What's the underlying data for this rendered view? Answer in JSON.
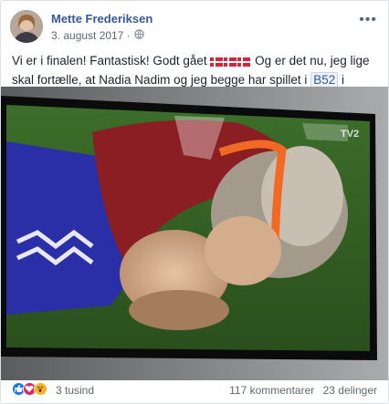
{
  "post": {
    "author": "Mette Frederiksen",
    "date": "3. august 2017 ·",
    "text_part1": "Vi er i finalen! Fantastisk! Godt gået",
    "text_part2": "Og er det nu, jeg lige skal fortælle, at Nadia Nadim og jeg begge har spillet i",
    "tag": "B52",
    "text_part3": "i Aalborg?",
    "emoji": "😀"
  },
  "footer": {
    "reaction_count": "3 tusind",
    "comments": "117 kommentarer",
    "shares": "23 delinger"
  },
  "overlay": {
    "broadcaster": "TV2"
  },
  "icons": {
    "privacy": "globe-icon",
    "menu": "more-options-icon",
    "reactions": [
      "like-icon",
      "love-icon",
      "wow-icon"
    ]
  },
  "colors": {
    "link": "#365899",
    "secondary_text": "#616770",
    "like": "#1877f2",
    "love": "#e0245e",
    "wow": "#f7b125"
  }
}
